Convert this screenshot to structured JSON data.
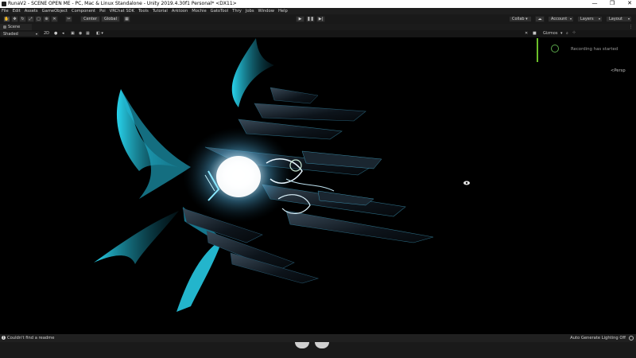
{
  "window": {
    "title": "RunaV2 - SCENE OPEN ME - PC, Mac & Linux Standalone - Unity 2019.4.30f1 Personal* <DX11>",
    "minimize": "—",
    "maximize": "❐",
    "close": "✕"
  },
  "menu": [
    "File",
    "Edit",
    "Assets",
    "GameObject",
    "Component",
    "Poi",
    "VRChat SDK",
    "Tools",
    "Tutorial",
    "Arktoon",
    "Mochie",
    "GatoTool",
    "Thry",
    "Jobs",
    "Window",
    "Help"
  ],
  "toolbar": {
    "pivot_label": "Center",
    "global_label": "Global",
    "collab_label": "Collab ▾",
    "account_label": "Account",
    "layers_label": "Layers",
    "layout_label": "Layout"
  },
  "tabs": {
    "scene": "Scene"
  },
  "scene": {
    "shading": "Shaded",
    "mode_2d": "2D",
    "gizmos": "Gizmos",
    "persp": "<Persp"
  },
  "overlay": {
    "recording": "Recording has started"
  },
  "status": {
    "message": "Couldn't find a readme",
    "lighting": "Auto Generate Lighting Off"
  },
  "colors": {
    "accent": "#2fc7e6",
    "recording": "#6cbf2a"
  }
}
